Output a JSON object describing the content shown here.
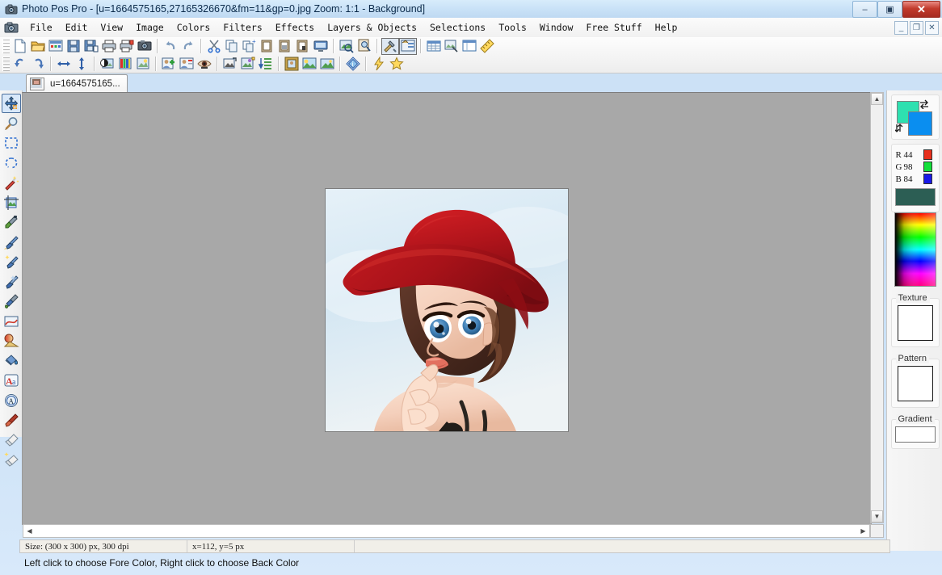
{
  "window": {
    "title": "Photo Pos Pro - [u=1664575165,27165326670&fm=11&gp=0.jpg  Zoom: 1:1 - Background]",
    "app_icon": "camera-icon",
    "watermark": "",
    "controls": {
      "minimize": "–",
      "maximize": "▣",
      "close": "✕"
    },
    "mdi_controls": {
      "minimize": "_",
      "restore": "❐",
      "close": "✕"
    }
  },
  "menu": {
    "items": [
      {
        "label": "File",
        "name": "menu-file"
      },
      {
        "label": "Edit",
        "name": "menu-edit"
      },
      {
        "label": "View",
        "name": "menu-view"
      },
      {
        "label": "Image",
        "name": "menu-image"
      },
      {
        "label": "Colors",
        "name": "menu-colors"
      },
      {
        "label": "Filters",
        "name": "menu-filters"
      },
      {
        "label": "Effects",
        "name": "menu-effects"
      },
      {
        "label": "Layers & Objects",
        "name": "menu-layers-objects"
      },
      {
        "label": "Selections",
        "name": "menu-selections"
      },
      {
        "label": "Tools",
        "name": "menu-tools"
      },
      {
        "label": "Window",
        "name": "menu-window"
      },
      {
        "label": "Free Stuff",
        "name": "menu-free-stuff"
      },
      {
        "label": "Help",
        "name": "menu-help"
      }
    ]
  },
  "toolbar_row1": [
    {
      "name": "new-file-icon",
      "tip": "New"
    },
    {
      "name": "open-folder-icon",
      "tip": "Open"
    },
    {
      "name": "open-from-gallery-icon",
      "tip": "Open Gallery"
    },
    {
      "name": "save-icon",
      "tip": "Save"
    },
    {
      "name": "save-as-icon",
      "tip": "Save As"
    },
    {
      "name": "print-icon",
      "tip": "Print"
    },
    {
      "name": "print-multiple-icon",
      "tip": "Print Multiple"
    },
    {
      "name": "camera-import-icon",
      "tip": "Acquire from Camera"
    },
    {
      "sep": true
    },
    {
      "name": "undo-icon",
      "tip": "Undo"
    },
    {
      "name": "redo-icon",
      "tip": "Redo"
    },
    {
      "sep": true
    },
    {
      "name": "cut-scissors-icon",
      "tip": "Cut"
    },
    {
      "name": "copy-icon",
      "tip": "Copy"
    },
    {
      "name": "copy-merged-icon",
      "tip": "Copy Merged"
    },
    {
      "name": "paste-icon",
      "tip": "Paste"
    },
    {
      "name": "paste-into-icon",
      "tip": "Paste Into Selection"
    },
    {
      "name": "paste-as-new-icon",
      "tip": "Paste As New"
    },
    {
      "name": "screen-capture-icon",
      "tip": "Screen Capture"
    },
    {
      "sep": true
    },
    {
      "name": "zoom-image-icon",
      "tip": "Zoom"
    },
    {
      "name": "preview-image-icon",
      "tip": "Preview"
    },
    {
      "sep": true
    },
    {
      "name": "tools-hammer-icon",
      "tip": "Tools Panel",
      "pressed": true
    },
    {
      "name": "tool-options-icon",
      "tip": "Tool Options",
      "pressed": true
    },
    {
      "sep": true
    },
    {
      "name": "layers-grid-icon",
      "tip": "Layers"
    },
    {
      "name": "navigator-icon",
      "tip": "Navigator"
    },
    {
      "name": "histogram-icon",
      "tip": "Histogram"
    },
    {
      "name": "ruler-icon",
      "tip": "Ruler"
    }
  ],
  "toolbar_row2": [
    {
      "name": "rotate-left-icon",
      "tip": "Rotate Left"
    },
    {
      "name": "rotate-right-icon",
      "tip": "Rotate Right"
    },
    {
      "sep": true
    },
    {
      "name": "flip-horizontal-icon",
      "tip": "Flip Horizontal"
    },
    {
      "name": "flip-vertical-icon",
      "tip": "Flip Vertical"
    },
    {
      "sep": true
    },
    {
      "name": "brightness-contrast-icon",
      "tip": "Brightness / Contrast"
    },
    {
      "name": "color-balance-icon",
      "tip": "Color Balance"
    },
    {
      "name": "auto-enhance-icon",
      "tip": "Auto Enhance"
    },
    {
      "sep": true
    },
    {
      "name": "add-portrait-icon",
      "tip": "Portrait Tools"
    },
    {
      "name": "id-card-icon",
      "tip": "ID Photo"
    },
    {
      "name": "red-eye-icon",
      "tip": "Red Eye Removal"
    },
    {
      "sep": true
    },
    {
      "name": "image-resize-icon",
      "tip": "Resize Image"
    },
    {
      "name": "canvas-size-icon",
      "tip": "Canvas Size"
    },
    {
      "name": "batch-process-icon",
      "tip": "Batch Process"
    },
    {
      "sep": true
    },
    {
      "name": "picture-frame-icon",
      "tip": "Frames"
    },
    {
      "name": "scenery-effects-icon",
      "tip": "Scenery Effects"
    },
    {
      "name": "photo-collage-icon",
      "tip": "Collage"
    },
    {
      "sep": true
    },
    {
      "name": "info-diamond-icon",
      "tip": "Image Info"
    },
    {
      "sep": true
    },
    {
      "name": "quick-action-icon",
      "tip": "Quick Fix"
    },
    {
      "name": "favorites-star-icon",
      "tip": "Favorites"
    }
  ],
  "document_tab": {
    "label": "u=1664575165...",
    "thumbnail": "image-thumbnail"
  },
  "tool_palette": [
    {
      "name": "tool-move",
      "label": "Move",
      "active": true
    },
    {
      "name": "tool-zoom",
      "label": "Zoom"
    },
    {
      "name": "tool-rect-select",
      "label": "Rectangular Select"
    },
    {
      "name": "tool-lasso-select",
      "label": "Lasso Select"
    },
    {
      "name": "tool-magic-wand",
      "label": "Magic Wand"
    },
    {
      "name": "tool-crop",
      "label": "Crop"
    },
    {
      "name": "tool-eyedropper",
      "label": "Color Picker"
    },
    {
      "name": "tool-paintbrush",
      "label": "Paint Brush"
    },
    {
      "name": "tool-effect-brush",
      "label": "Effect Brush"
    },
    {
      "name": "tool-clone-brush",
      "label": "Clone Brush"
    },
    {
      "name": "tool-retouch",
      "label": "Retouch"
    },
    {
      "name": "tool-shapes",
      "label": "Shapes / Lines"
    },
    {
      "name": "tool-gradient",
      "label": "Gradient Fill"
    },
    {
      "name": "tool-paint-bucket",
      "label": "Paint Bucket"
    },
    {
      "name": "tool-text",
      "label": "Text"
    },
    {
      "name": "tool-vector-object",
      "label": "Vector Object"
    },
    {
      "name": "tool-smudge",
      "label": "Smudge"
    },
    {
      "name": "tool-eraser",
      "label": "Eraser"
    },
    {
      "name": "tool-magic-eraser",
      "label": "Magic Eraser"
    }
  ],
  "color_panel": {
    "foreground_color": "#0a8ef0",
    "background_color": "#2ee0b0",
    "swap_icon": "swap-arrows-icon",
    "channels": [
      {
        "label": "R",
        "value": "44",
        "chip": "#e8301d"
      },
      {
        "label": "G",
        "value": "98",
        "chip": "#13e03a"
      },
      {
        "label": "B",
        "value": "84",
        "chip": "#1a1ae8"
      }
    ],
    "current_color": "#2c5e54",
    "spectrum_label": "color-spectrum",
    "texture": {
      "label": "Texture",
      "value": "#ffffff"
    },
    "pattern": {
      "label": "Pattern",
      "value": "#ffffff"
    },
    "gradient": {
      "label": "Gradient",
      "value": "#ffffff"
    }
  },
  "canvas": {
    "artboard_width": 300,
    "artboard_height": 300,
    "background_color": "#a8a8a8",
    "image_description": "Cartoon illustration of a young woman wearing a wide-brimmed red hat, with wavy brown hair, large blue eyes, a finger held to her lips, and a black strap top, against a pale blue sky background."
  },
  "status": {
    "size": "Size: (300 x 300) px, 300 dpi",
    "cursor": "x=112, y=5 px",
    "extra": "",
    "hint": "Left click to choose Fore Color, Right click to choose Back Color"
  },
  "scrollbars": {
    "vertical": {
      "up": "▲",
      "down": "▼"
    },
    "horizontal": {
      "left": "◀",
      "right": "▶"
    }
  }
}
